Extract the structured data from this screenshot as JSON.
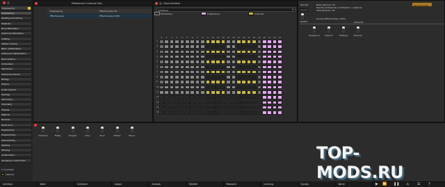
{
  "research_list": {
    "header": "Engineering",
    "items": [
      "Engineering",
      "Reading and writing",
      "Plasticity",
      "Bone fabrication",
      "Advanced fabrication",
      "Crafting",
      "Skilled cooking",
      "Basic mathematics",
      "Advanced mathematics",
      "Book science",
      "Computers",
      "Mechanics",
      "Advanced science",
      "Biology",
      "Physics",
      "Joules physics",
      "Geology",
      "Astronomy",
      "Chemistry",
      "Physiqs",
      "Medical",
      "Biochem",
      "Electronics",
      "Engineering",
      "Programming",
      "Ship building",
      "Spelling",
      "Tutoring",
      "Construction",
      "Aerospace construction"
    ],
    "footer_label": "T: Cue team",
    "footer_value": "Learned"
  },
  "preferences": {
    "title": "Preferences in Learner Plan",
    "rows": [
      {
        "name": "Engineering",
        "value": "Effectiveness 0%"
      },
      {
        "name": "Effectiveness",
        "value": "Effectiveness 100%"
      }
    ]
  },
  "schedule": {
    "title": "Class Schedule",
    "dropdown": "Schedule",
    "legend": [
      {
        "label": "Elementary",
        "color": "#2e2e2e"
      },
      {
        "label": "Engineering",
        "color": "#e6a8f2"
      },
      {
        "label": "Sciences",
        "color": "#c8b94a"
      }
    ],
    "hours": [
      "0",
      "1",
      "2",
      "3",
      "4",
      "5",
      "6",
      "7",
      "8",
      "9",
      "10",
      "11",
      "12",
      "13",
      "14",
      "15",
      "16",
      "17",
      "18",
      "19",
      "20",
      "21",
      "22",
      "23"
    ],
    "rows": [
      "1",
      "2",
      "3",
      "4",
      "5",
      "6",
      "7",
      "8",
      "9",
      "10",
      "11",
      "12",
      "13",
      "14",
      "15"
    ]
  },
  "teacher": {
    "label": "Teacher",
    "name": "Lassitor",
    "info": [
      "Base spillover: 22",
      "Teacher intellectual contribution: 1 spillover",
      "Total spillover: 36"
    ],
    "overall": "Overall effectiveness: 100%",
    "students_title": "Students",
    "students": [
      "Redgwood",
      "Valsarm",
      "Stalberg",
      "Bramari"
    ]
  },
  "pawns": [
    "Valsanne",
    "Bathy",
    "Haugari",
    "Vicky",
    "Slym",
    "Nishaz",
    "Beryn"
  ],
  "top_right": {
    "label": "Tech Purchase"
  },
  "watermark": "TOP-MODS.RU",
  "bottom_tabs": [
    "Architect",
    "Work",
    "Schedule",
    "Assign",
    "Animals",
    "Wildlife",
    "Research",
    "Learning",
    "Quests",
    "World"
  ],
  "colors": {
    "engineering": "#e6a8f2",
    "sciences": "#c8b94a",
    "close": "#c62828"
  }
}
